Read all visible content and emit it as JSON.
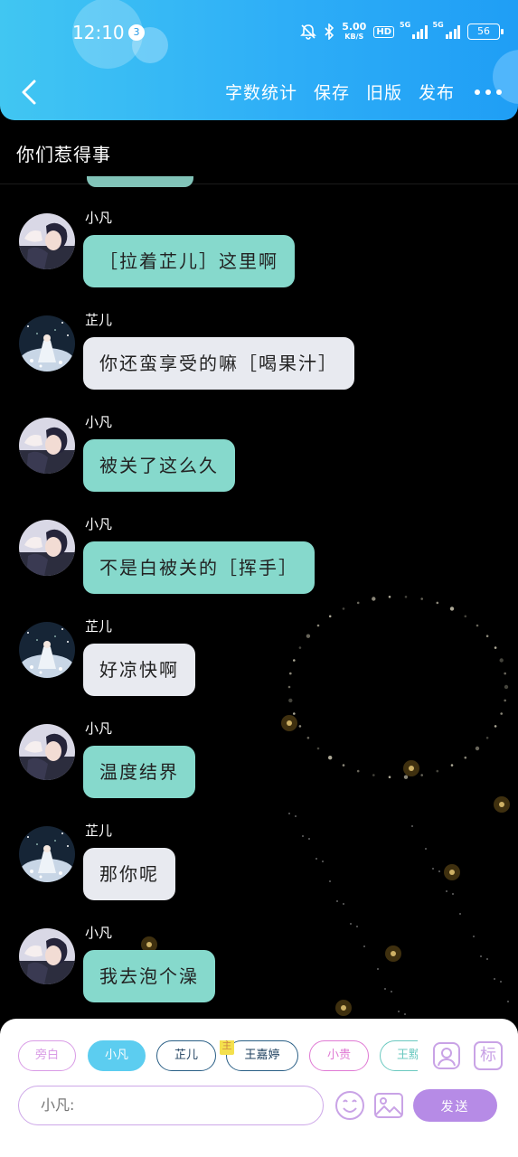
{
  "status_bar": {
    "time": "12:10",
    "notification_count": "3",
    "net_speed": "5.00",
    "net_speed_unit": "KB/S",
    "hd_label": "HD",
    "signal_1_label": "5G",
    "signal_2_label": "5G",
    "battery": "56"
  },
  "header": {
    "word_count_label": "字数统计",
    "save_label": "保存",
    "old_version_label": "旧版",
    "publish_label": "发布"
  },
  "title": "你们惹得事",
  "messages": [
    {
      "sender": "小凡",
      "text": "［拉着芷儿］这里啊",
      "style": "teal",
      "avatar": "xiaofan"
    },
    {
      "sender": "芷儿",
      "text": "你还蛮享受的嘛［喝果汁］",
      "style": "grey",
      "avatar": "zhier"
    },
    {
      "sender": "小凡",
      "text": "被关了这么久",
      "style": "teal",
      "avatar": "xiaofan"
    },
    {
      "sender": "小凡",
      "text": "不是白被关的［挥手］",
      "style": "teal",
      "avatar": "xiaofan"
    },
    {
      "sender": "芷儿",
      "text": "好凉快啊",
      "style": "grey",
      "avatar": "zhier"
    },
    {
      "sender": "小凡",
      "text": "温度结界",
      "style": "teal",
      "avatar": "xiaofan"
    },
    {
      "sender": "芷儿",
      "text": "那你呢",
      "style": "grey",
      "avatar": "zhier"
    },
    {
      "sender": "小凡",
      "text": "我去泡个澡",
      "style": "teal",
      "avatar": "xiaofan"
    }
  ],
  "roles": [
    {
      "label": "旁白",
      "color": "#d99be6",
      "active": false
    },
    {
      "label": "小凡",
      "color": "#5ccdf0",
      "active": true
    },
    {
      "label": "芷儿",
      "color": "#2a5f86",
      "active": false
    },
    {
      "label": "王嘉婷",
      "color": "#2a5f86",
      "active": false,
      "owner_tag": "主"
    },
    {
      "label": "小贵",
      "color": "#e07ad4",
      "active": false
    },
    {
      "label": "王黥",
      "color": "#6bc9c0",
      "active": false
    }
  ],
  "composer": {
    "placeholder": "小凡:",
    "send_label": "发送",
    "tag_icon_label": "标"
  },
  "colors": {
    "header_start": "#41c6f2",
    "header_end": "#1f9ef5",
    "bubble_teal": "#86d9cc",
    "bubble_grey": "#e8eaf0",
    "accent_purple": "#b68be6"
  }
}
